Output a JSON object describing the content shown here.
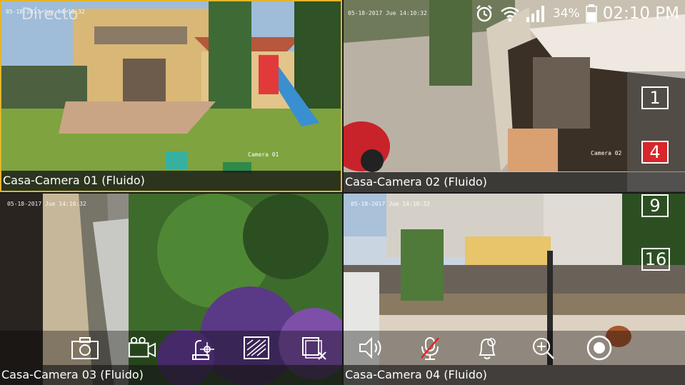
{
  "header": {
    "mode_label": "Directo"
  },
  "status_bar": {
    "battery_percent": "34%",
    "time": "02:10 PM"
  },
  "cameras": [
    {
      "caption": "Casa-Camera 01 (Fluido)",
      "timestamp": "05-18-2017 Jue 14:10:32",
      "osd_name": "Camera 01"
    },
    {
      "caption": "Casa-Camera 02 (Fluido)",
      "timestamp": "05-18-2017 Jue 14:10:32",
      "osd_name": "Camera 02"
    },
    {
      "caption": "Casa-Camera 03 (Fluido)",
      "timestamp": "05-18-2017 Jue 14:10:32",
      "osd_name": ""
    },
    {
      "caption": "Casa-Camera 04 (Fluido)",
      "timestamp": "05-18-2017 Jue 14:10:32",
      "osd_name": ""
    }
  ],
  "layout_options": [
    {
      "label": "1",
      "active": false
    },
    {
      "label": "4",
      "active": true
    },
    {
      "label": "9",
      "active": false
    },
    {
      "label": "16",
      "active": false
    }
  ],
  "toolbar": {
    "buttons": [
      {
        "icon": "camera-snapshot-icon"
      },
      {
        "icon": "video-record-icon"
      },
      {
        "icon": "ptz-control-icon"
      },
      {
        "icon": "image-quality-icon"
      },
      {
        "icon": "close-window-icon"
      },
      {
        "icon": "audio-icon"
      },
      {
        "icon": "microphone-muted-icon"
      },
      {
        "icon": "alarm-bell-icon"
      },
      {
        "icon": "zoom-in-icon"
      },
      {
        "icon": "record-icon"
      }
    ]
  },
  "colors": {
    "selected_border": "#e2b42a",
    "active_layout": "#d8262b"
  }
}
